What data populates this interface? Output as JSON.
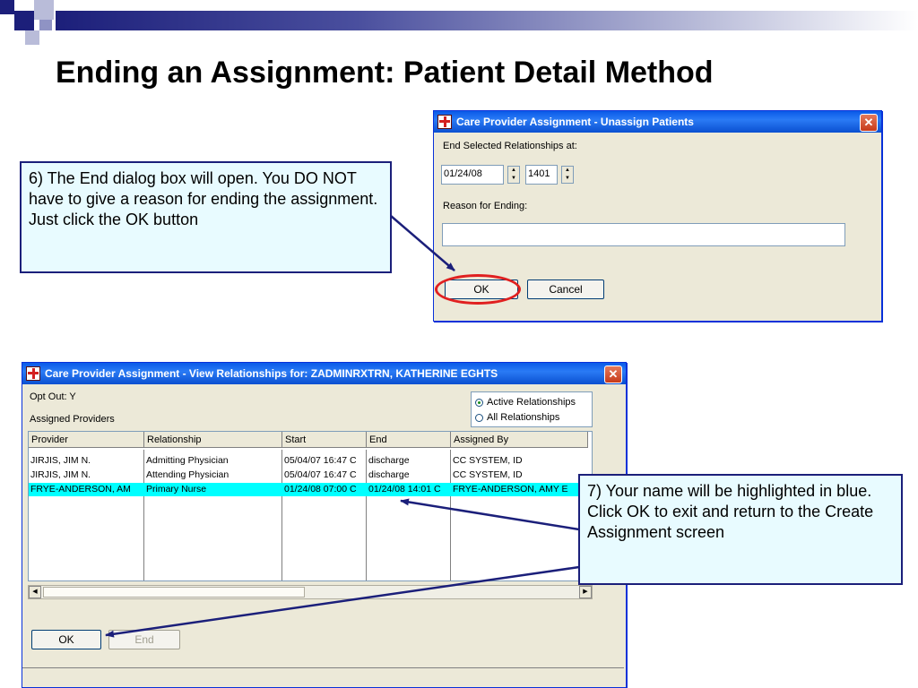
{
  "slide": {
    "title": "Ending an Assignment: Patient Detail Method"
  },
  "unassign_dialog": {
    "title": "Care Provider Assignment - Unassign Patients",
    "end_label": "End Selected Relationships at:",
    "date_value": "01/24/08",
    "time_value": "1401",
    "reason_label": "Reason for Ending:",
    "reason_value": "",
    "ok_label": "OK",
    "cancel_label": "Cancel"
  },
  "relationships_window": {
    "title": "Care Provider Assignment - View Relationships for: ZADMINRXTRN, KATHERINE EGHTS",
    "opt_out": "Opt Out: Y",
    "assigned_providers_label": "Assigned Providers",
    "filter_options": [
      {
        "label": "Active Relationships",
        "selected": true
      },
      {
        "label": "All Relationships",
        "selected": false
      }
    ],
    "columns": [
      "Provider",
      "Relationship",
      "Start",
      "End",
      "Assigned By"
    ],
    "rows": [
      {
        "provider": "JIRJIS, JIM N.",
        "relationship": "Admitting Physician",
        "start": "05/04/07 16:47 C",
        "end": "discharge",
        "assigned_by": "CC SYSTEM, ID",
        "selected": false
      },
      {
        "provider": "JIRJIS, JIM N.",
        "relationship": "Attending Physician",
        "start": "05/04/07 16:47 C",
        "end": "discharge",
        "assigned_by": "CC SYSTEM, ID",
        "selected": false
      },
      {
        "provider": "FRYE-ANDERSON, AM",
        "relationship": "Primary Nurse",
        "start": "01/24/08 07:00 C",
        "end": "01/24/08 14:01 C",
        "assigned_by": "FRYE-ANDERSON, AMY E",
        "selected": true
      }
    ],
    "ok_label": "OK",
    "end_label": "End"
  },
  "callouts": {
    "step6": "6) The End dialog box will open. You DO NOT have to give a reason for ending the assignment. Just click the OK button",
    "step7": "7) Your name will be highlighted in blue. Click OK to exit and return to the Create Assignment screen"
  },
  "colors": {
    "selected_row": "#00ffff",
    "callout_border": "#1b1f7a",
    "callout_fill": "#e8fbff",
    "highlight_ring": "#e02020",
    "title_bar": "#0a5ae8"
  }
}
